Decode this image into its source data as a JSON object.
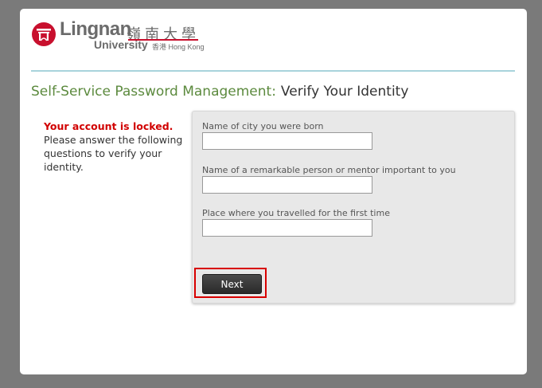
{
  "logo": {
    "name_en": "Lingnan",
    "name_cn": "嶺南大學",
    "university": "University",
    "location_cn": "香港",
    "location_en": "Hong Kong",
    "brand_color": "#c8102e"
  },
  "header": {
    "section": "Self-Service Password Management:",
    "subtitle": "Verify Your Identity"
  },
  "message": {
    "locked": "Your account is locked.",
    "instructions": "Please answer the following questions to verify your identity."
  },
  "form": {
    "questions": [
      {
        "label": "Name of city you were born",
        "value": ""
      },
      {
        "label": "Name of a remarkable person or mentor important to you",
        "value": ""
      },
      {
        "label": "Place where you travelled for the first time",
        "value": ""
      }
    ],
    "next_label": "Next"
  },
  "colors": {
    "section_title": "#5c8a3e",
    "locked_text": "#d10000",
    "divider": "#a8d3dc",
    "highlight_border": "#d80000"
  }
}
